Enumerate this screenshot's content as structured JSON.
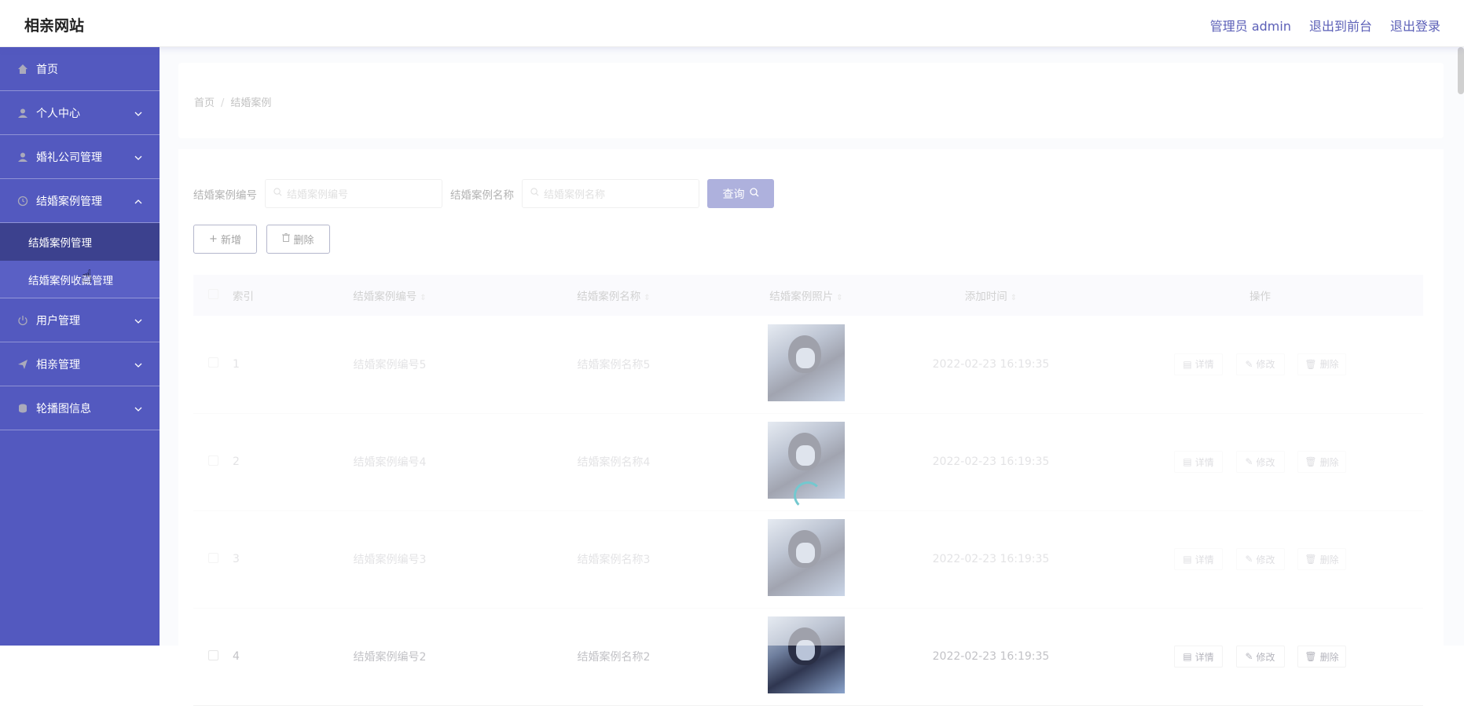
{
  "app": {
    "title": "相亲网站"
  },
  "topnav": {
    "admin": "管理员 admin",
    "front": "退出到前台",
    "logout": "退出登录"
  },
  "sidebar": {
    "items": [
      {
        "label": "首页",
        "icon": "home-icon"
      },
      {
        "label": "个人中心",
        "icon": "user-icon"
      },
      {
        "label": "婚礼公司管理",
        "icon": "user-icon"
      },
      {
        "label": "结婚案例管理",
        "icon": "clock-icon"
      },
      {
        "label": "用户管理",
        "icon": "power-icon"
      },
      {
        "label": "相亲管理",
        "icon": "send-icon"
      },
      {
        "label": "轮播图信息",
        "icon": "coin-icon"
      }
    ],
    "submenu": [
      {
        "label": "结婚案例管理"
      },
      {
        "label": "结婚案例收藏管理"
      }
    ]
  },
  "breadcrumb": {
    "home": "首页",
    "sep": "/",
    "current": "结婚案例"
  },
  "search": {
    "label1": "结婚案例编号",
    "placeholder1": "结婚案例编号",
    "label2": "结婚案例名称",
    "placeholder2": "结婚案例名称",
    "query": "查询"
  },
  "actions": {
    "add": "新增",
    "delete": "删除"
  },
  "table": {
    "headers": {
      "index": "索引",
      "code": "结婚案例编号",
      "name": "结婚案例名称",
      "photo": "结婚案例照片",
      "time": "添加时间",
      "ops": "操作"
    },
    "rows": [
      {
        "idx": "1",
        "code": "结婚案例编号5",
        "name": "结婚案例名称5",
        "time": "2022-02-23 16:19:35"
      },
      {
        "idx": "2",
        "code": "结婚案例编号4",
        "name": "结婚案例名称4",
        "time": "2022-02-23 16:19:35"
      },
      {
        "idx": "3",
        "code": "结婚案例编号3",
        "name": "结婚案例名称3",
        "time": "2022-02-23 16:19:35"
      },
      {
        "idx": "4",
        "code": "结婚案例编号2",
        "name": "结婚案例名称2",
        "time": "2022-02-23 16:19:35"
      }
    ],
    "ops": {
      "detail": "详情",
      "edit": "修改",
      "delete": "删除"
    }
  },
  "colors": {
    "sidebar": "#5359bf",
    "accent": "#4d52b4",
    "active_sub": "#3c418e"
  }
}
